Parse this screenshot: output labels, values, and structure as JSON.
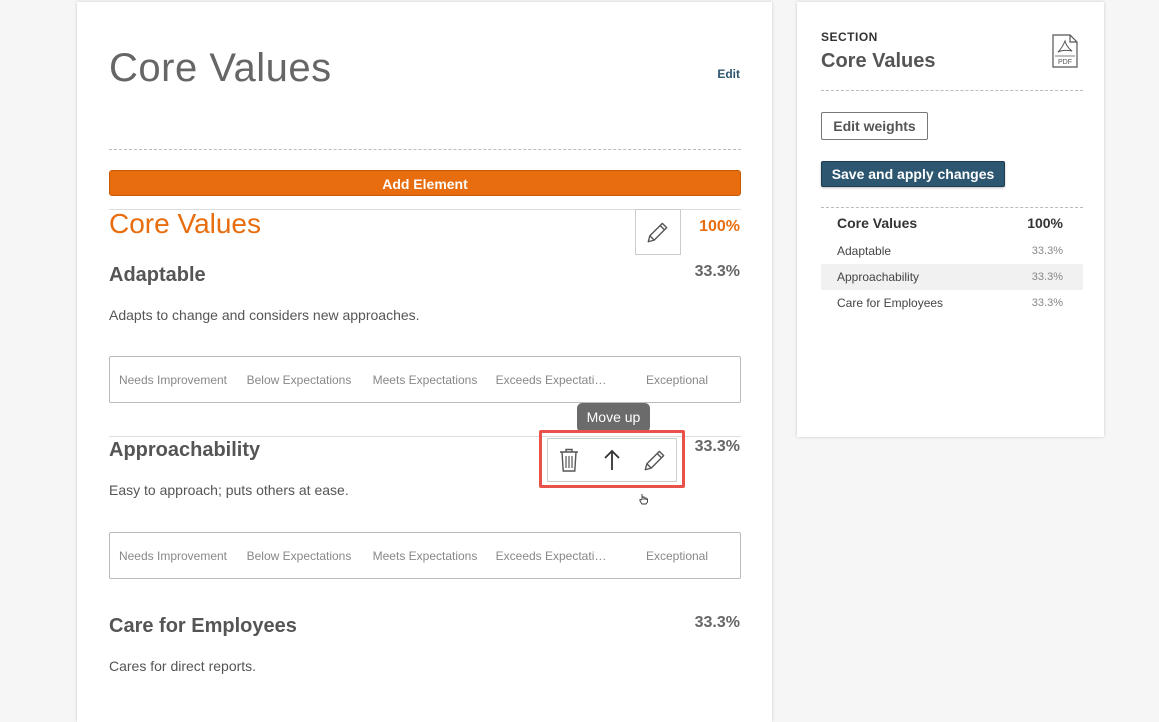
{
  "main": {
    "title": "Core Values",
    "edit_link": "Edit",
    "add_element_label": "Add Element",
    "section": {
      "heading": "Core Values",
      "percent": "100%"
    },
    "elements": [
      {
        "title": "Adaptable",
        "percent": "33.3%",
        "description": "Adapts to change and considers new approaches.",
        "scale": [
          "Needs Improvement",
          "Below Expectations",
          "Meets Expectations",
          "Exceeds Expectati…",
          "Exceptional"
        ]
      },
      {
        "title": "Approachability",
        "percent": "33.3%",
        "description": "Easy to approach; puts others at ease.",
        "scale": [
          "Needs Improvement",
          "Below Expectations",
          "Meets Expectations",
          "Exceeds Expectati…",
          "Exceptional"
        ]
      },
      {
        "title": "Care for Employees",
        "percent": "33.3%",
        "description": "Cares for direct reports."
      }
    ],
    "tooltip": "Move up",
    "toolbar_icons": [
      "trash-icon",
      "arrow-up-icon",
      "pencil-icon"
    ]
  },
  "side": {
    "label": "SECTION",
    "title": "Core Values",
    "pdf_icon_text": "PDF",
    "edit_weights_label": "Edit weights",
    "save_label": "Save and apply changes",
    "weights": {
      "head": {
        "name": "Core Values",
        "percent": "100%"
      },
      "items": [
        {
          "name": "Adaptable",
          "percent": "33.3%"
        },
        {
          "name": "Approachability",
          "percent": "33.3%"
        },
        {
          "name": "Care for Employees",
          "percent": "33.3%"
        }
      ]
    }
  },
  "colors": {
    "accent_orange": "#e86d0e",
    "primary_blue": "#2d5670",
    "highlight_red": "#e8524a",
    "tooltip_gray": "#6b6b6b"
  }
}
